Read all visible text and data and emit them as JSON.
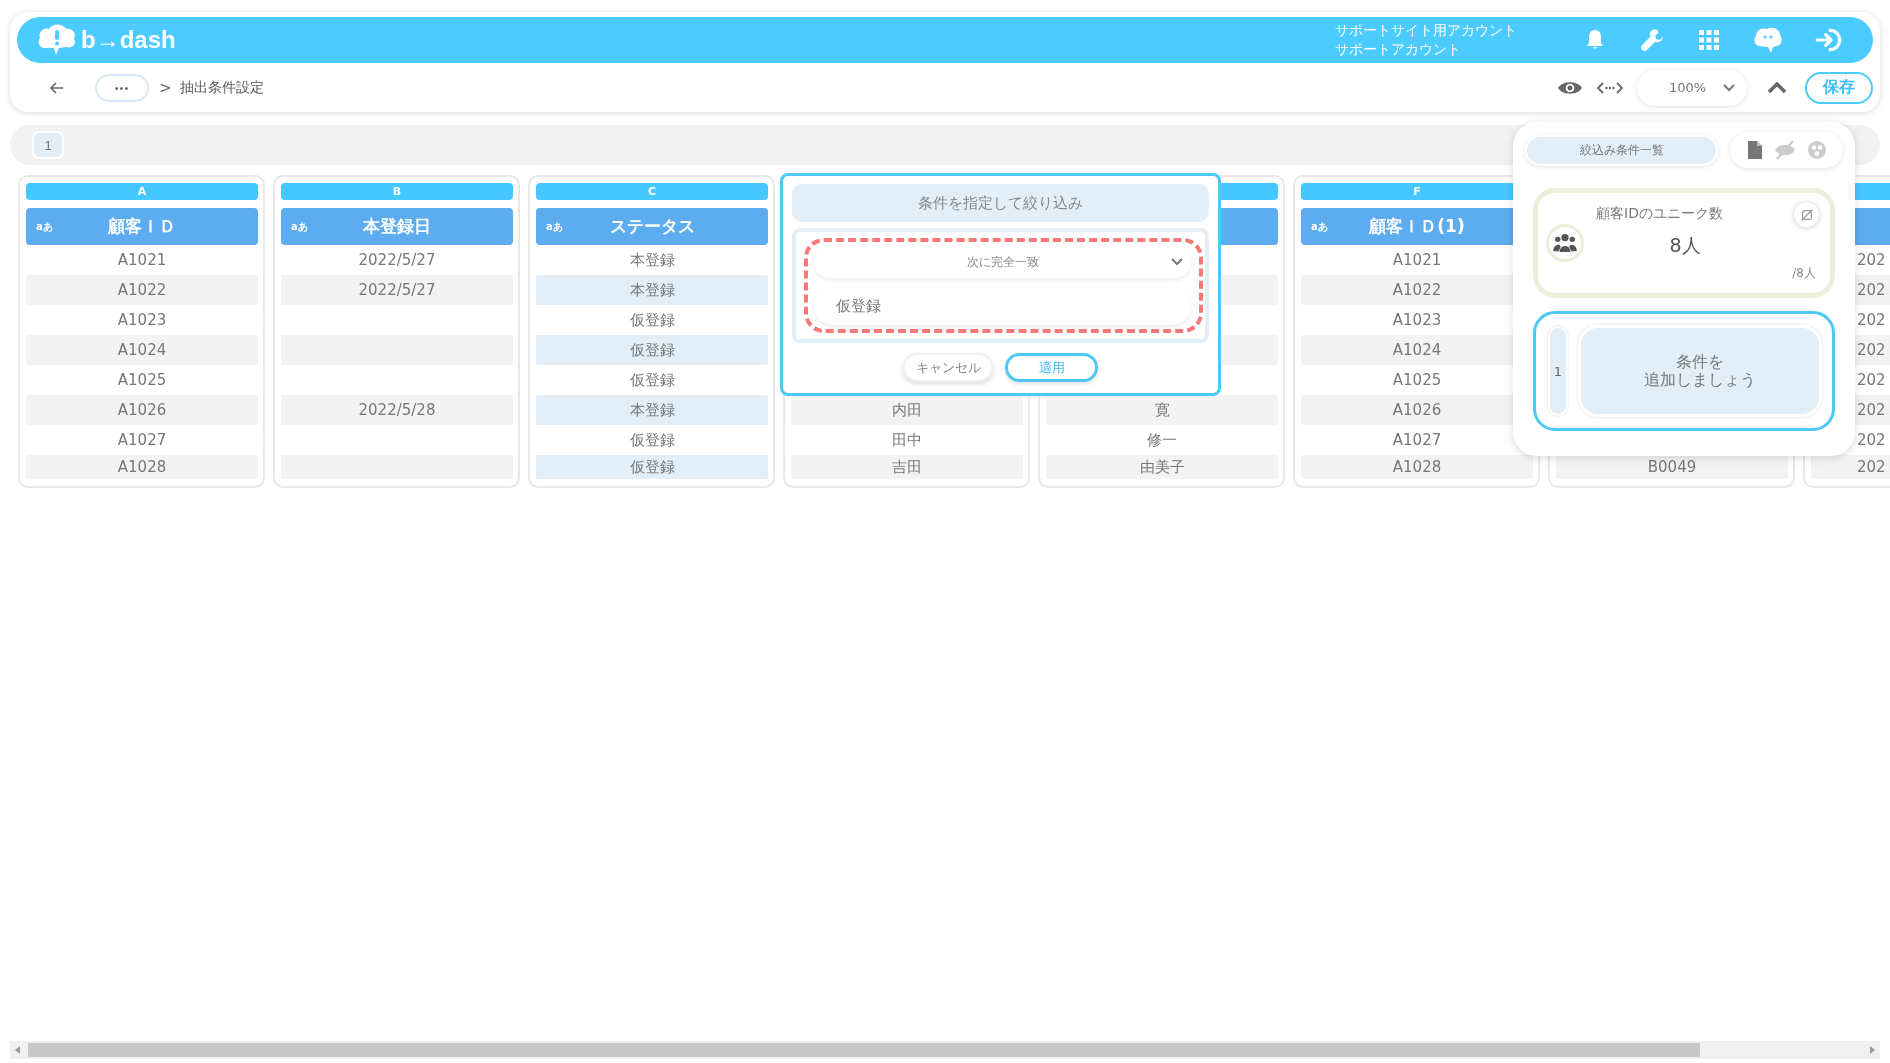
{
  "header": {
    "logo": "b→dash",
    "account_lines": [
      "サポートサイト用アカウント",
      "サポートアカウント"
    ]
  },
  "breadcrumb": {
    "more": "•••",
    "separator": ">",
    "current": "抽出条件設定"
  },
  "toolbar": {
    "zoom": "100%",
    "save": "保存"
  },
  "sheet_tabs": [
    {
      "label": "1",
      "selected": true
    }
  ],
  "columns": [
    {
      "letter": "A",
      "type_tag": "aあ",
      "title": "顧客ＩＤ",
      "selected": false,
      "cells": [
        "A1021",
        "A1022",
        "A1023",
        "A1024",
        "A1025",
        "A1026",
        "A1027",
        "A1028"
      ]
    },
    {
      "letter": "B",
      "type_tag": "aあ",
      "title": "本登録日",
      "selected": false,
      "cells": [
        "2022/5/27",
        "2022/5/27",
        null,
        null,
        null,
        "2022/5/28",
        null,
        null
      ]
    },
    {
      "letter": "C",
      "type_tag": "aあ",
      "title": "ステータス",
      "selected": true,
      "cells": [
        "本登録",
        "本登録",
        "仮登録",
        "仮登録",
        "仮登録",
        "本登録",
        "仮登録",
        "仮登録"
      ]
    },
    {
      "selected": false,
      "cells": [
        null,
        null,
        null,
        null,
        null,
        "内田",
        "田中",
        "吉田"
      ]
    },
    {
      "selected": false,
      "cells": [
        null,
        null,
        null,
        null,
        null,
        "寛",
        "修一",
        "由美子"
      ]
    },
    {
      "letter": "F",
      "type_tag": "aあ",
      "title": "顧客ＩＤ(1)",
      "selected": false,
      "cells": [
        "A1021",
        "A1022",
        "A1023",
        "A1024",
        "A1025",
        "A1026",
        "A1027",
        "A1028"
      ]
    },
    {
      "selected": false,
      "cells": [
        null,
        null,
        null,
        null,
        null,
        null,
        null,
        "B0049"
      ]
    },
    {
      "selected": false,
      "cells": [
        "202",
        "202",
        "202",
        "202",
        "202",
        "202",
        "202",
        "202"
      ]
    }
  ],
  "filter_popup": {
    "title": "条件を指定して絞り込み",
    "operator": "次に完全一致",
    "value": "仮登録",
    "buttons": [
      {
        "label": "キャンセル",
        "kind": "secondary"
      },
      {
        "label": "適用",
        "kind": "primary"
      }
    ]
  },
  "side_panel": {
    "tab": "絞込み条件一覧",
    "count_card": {
      "title": "顧客IDのユニーク数",
      "count": "8人",
      "total": "/8人"
    },
    "conditions": [
      {
        "number": "1",
        "text_lines": [
          "条件を",
          "追加しましょう"
        ]
      }
    ]
  }
}
